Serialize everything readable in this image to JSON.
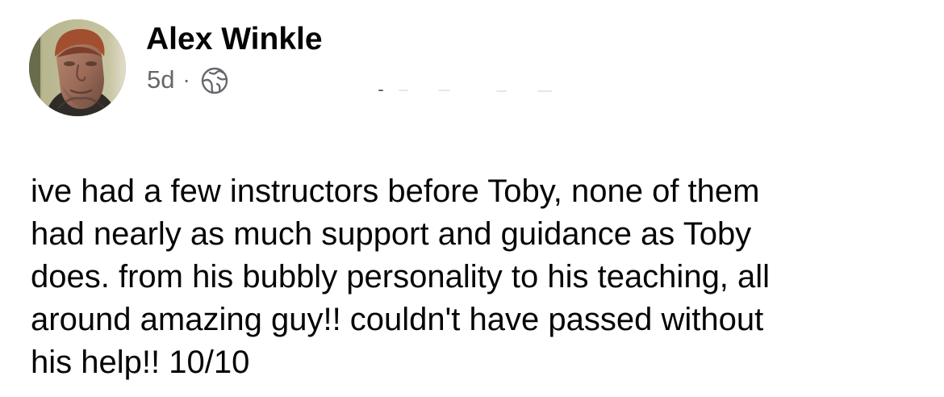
{
  "post": {
    "author": {
      "name": "Alex Winkle",
      "avatar_icon": "profile-photo"
    },
    "timestamp": "5d",
    "separator": "·",
    "privacy_icon": "globe-icon",
    "body": "ive had a few instructors before Toby, none of them\nhad nearly as much support and guidance as Toby\ndoes. from his bubbly personality to his teaching, all\naround amazing guy!! couldn't have passed without\nhis help!! 10/10"
  },
  "colors": {
    "name_text": "#050505",
    "secondary_text": "#65676b",
    "background": "#ffffff"
  }
}
